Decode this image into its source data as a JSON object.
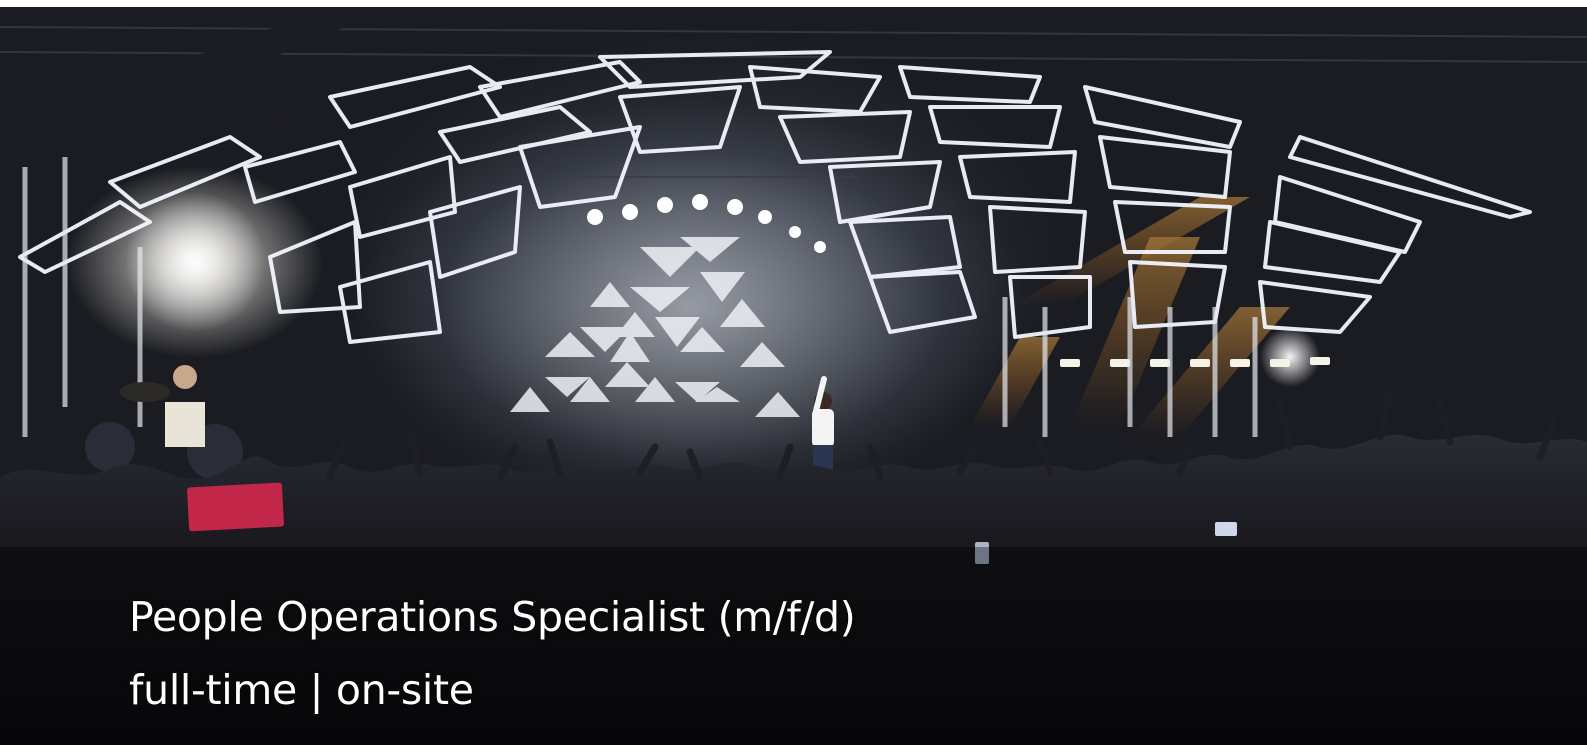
{
  "hero": {
    "image_label": "concert stage with lighting rig and crowd",
    "title": "People Operations Specialist (m/f/d)",
    "subtitle": "full-time | on-site"
  }
}
